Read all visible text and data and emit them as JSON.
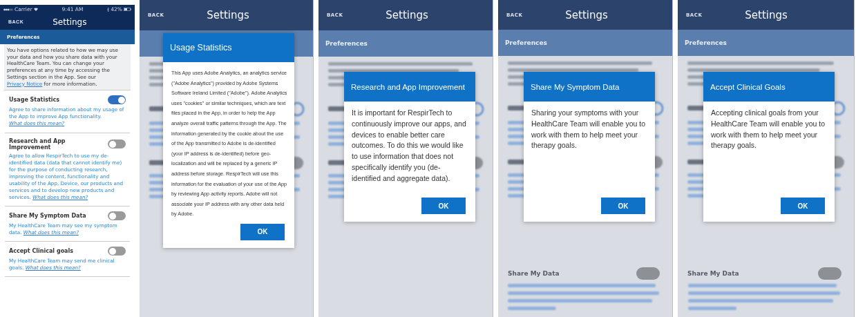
{
  "screens": [
    {
      "kind": "settings",
      "status_bar": {
        "carrier": "Carrier",
        "time": "9:41 AM",
        "battery": "42%"
      },
      "nav": {
        "back": "BACK",
        "title": "Settings"
      },
      "section": "Preferences",
      "intro": {
        "text": "You have options related to how we may use your data and how you share data with your HealthCare Team.  You can change your preferences at any time by accessing the Settings section in the App.  See our",
        "link": "Privacy Notice",
        "after": "for more information."
      },
      "items": [
        {
          "title": "Usage Statistics",
          "on": true,
          "description": "Agree to share information about my usage of the App to improve App functionality.",
          "link": "What does this mean?"
        },
        {
          "title": "Research and App Improvement",
          "on": false,
          "description": "Agree to allow RespirTech to use my de-identified data (data that cannot identify me) for the purpose of conducting research, improving the content, functionality and usability of the App, Device, our products and services and to develop new products and services.",
          "link": "What does this mean?"
        },
        {
          "title": "Share My Symptom Data",
          "on": false,
          "description": "My HealthCare Team may see my symptom data.",
          "link": "What does this mean?"
        },
        {
          "title": "Accept Clinical goals",
          "on": false,
          "description": "My HealthCare Team may send me clinical goals.",
          "link": "What does this mean?"
        }
      ]
    },
    {
      "kind": "dialog",
      "backdrop": {
        "back": "BACK",
        "title": "Settings"
      },
      "dialog": {
        "title": "Usage Statistics",
        "body": "This App uses Adobe Analytics, an analytics service (\"Adobe Analytics\") provided by Adobe Systems Software Ireland Limited (\"Adobe\"). Adobe Analytics uses \"cookies\" or similar techniques, which are text files placed in the App, in order to help the App analyze overall traffic patterns through the App. The information generated by the cookie about the use of the App transmitted to Adobe is de-identified (your IP address is de-identified) before geo-localization and will be replaced by a generic IP address before storage. RespirTech will use this information for the evaluation of your use of the App by reviewing App activity reports. Adobe will not associate your IP address with any other data held by Adobe.",
        "button": "OK"
      }
    },
    {
      "kind": "dialog",
      "backdrop": {
        "back": "BACK",
        "title": "Settings",
        "section": "Preferences"
      },
      "dialog": {
        "title": "Research and App Improvement",
        "body": "It is important for RespirTech to continuously improve our apps, and devices to enable better care outcomes. To do this we would like to use information that does not specifically identify you (de-identified and aggregate data).",
        "button": "OK"
      }
    },
    {
      "kind": "dialog",
      "backdrop": {
        "back": "BACK",
        "title": "Settings",
        "section": "Preferences",
        "lower_item": "Share My Data"
      },
      "dialog": {
        "title": "Share My Symptom Data",
        "body": "Sharing your symptoms with your HealthCare Team will enable you to work with them to help meet your therapy goals.",
        "button": "OK"
      }
    },
    {
      "kind": "dialog",
      "backdrop": {
        "back": "BACK",
        "title": "Settings",
        "section": "Preferences",
        "lower_item": "Share My Data"
      },
      "dialog": {
        "title": "Accept Clinical Goals",
        "body": "Accepting clinical goals from your HealthCare Team will enable you to work with them to help meet your therapy goals.",
        "button": "OK"
      }
    }
  ]
}
